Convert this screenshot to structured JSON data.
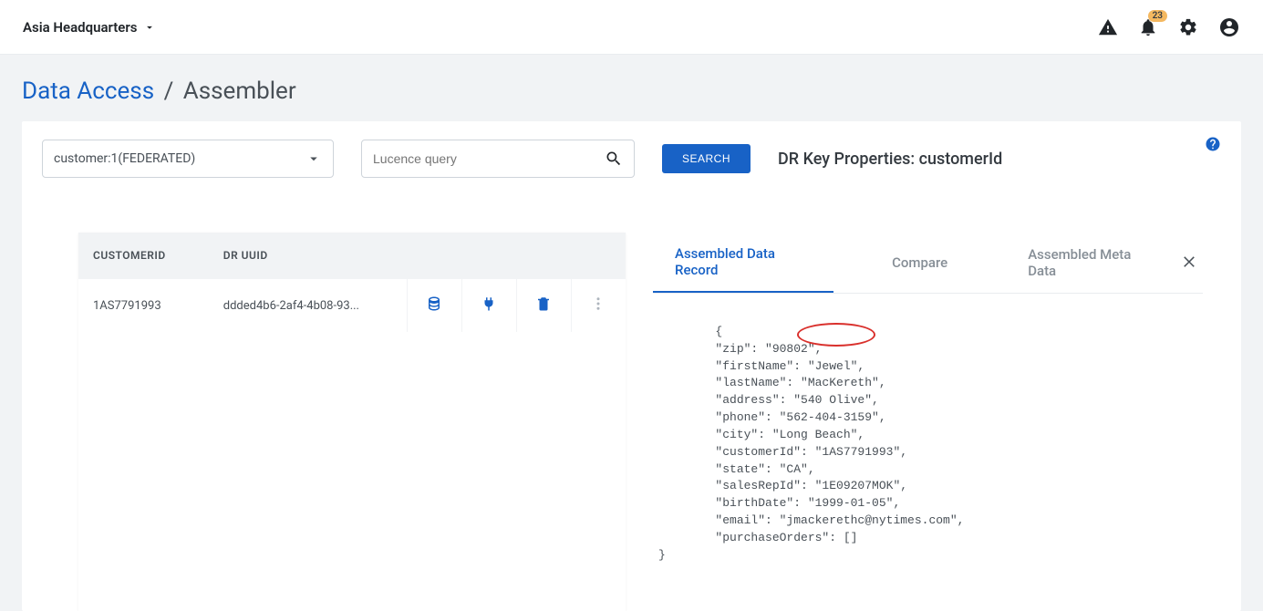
{
  "header": {
    "org": "Asia Headquarters",
    "notification_count": "23"
  },
  "breadcrumb": {
    "link": "Data Access",
    "current": "Assembler"
  },
  "controls": {
    "selected_source": "customer:1(FEDERATED)",
    "query_placeholder": "Lucence query",
    "search_btn": "SEARCH",
    "key_props_label": "DR Key Properties: customerId"
  },
  "table": {
    "headers": [
      "CUSTOMERID",
      "DR UUID"
    ],
    "rows": [
      {
        "customerId": "1AS7791993",
        "uuid": "ddded4b6-2af4-4b08-93..."
      }
    ]
  },
  "tabs": {
    "t1": "Assembled Data Record",
    "t2": "Compare",
    "t3": "Assembled Meta Data"
  },
  "record_json": "{\n        \"zip\": \"90802\",\n        \"firstName\": \"Jewel\",\n        \"lastName\": \"MacKereth\",\n        \"address\": \"540 Olive\",\n        \"phone\": \"562-404-3159\",\n        \"city\": \"Long Beach\",\n        \"customerId\": \"1AS7791993\",\n        \"state\": \"CA\",\n        \"salesRepId\": \"1E09207MOK\",\n        \"birthDate\": \"1999-01-05\",\n        \"email\": \"jmackerethc@nytimes.com\",\n        \"purchaseOrders\": []\n}"
}
